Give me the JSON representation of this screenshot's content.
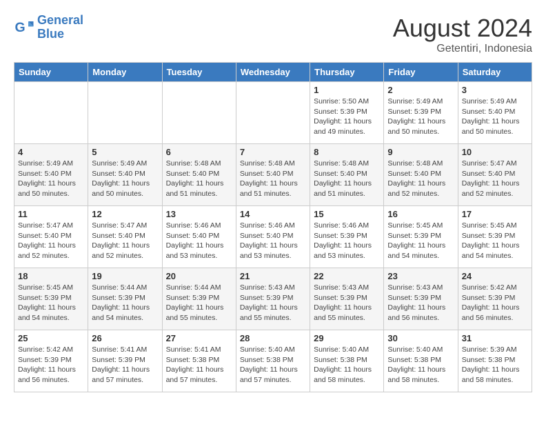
{
  "logo": {
    "line1": "General",
    "line2": "Blue"
  },
  "title": "August 2024",
  "location": "Getentiri, Indonesia",
  "weekdays": [
    "Sunday",
    "Monday",
    "Tuesday",
    "Wednesday",
    "Thursday",
    "Friday",
    "Saturday"
  ],
  "weeks": [
    [
      {
        "day": "",
        "info": ""
      },
      {
        "day": "",
        "info": ""
      },
      {
        "day": "",
        "info": ""
      },
      {
        "day": "",
        "info": ""
      },
      {
        "day": "1",
        "info": "Sunrise: 5:50 AM\nSunset: 5:39 PM\nDaylight: 11 hours\nand 49 minutes."
      },
      {
        "day": "2",
        "info": "Sunrise: 5:49 AM\nSunset: 5:39 PM\nDaylight: 11 hours\nand 50 minutes."
      },
      {
        "day": "3",
        "info": "Sunrise: 5:49 AM\nSunset: 5:40 PM\nDaylight: 11 hours\nand 50 minutes."
      }
    ],
    [
      {
        "day": "4",
        "info": "Sunrise: 5:49 AM\nSunset: 5:40 PM\nDaylight: 11 hours\nand 50 minutes."
      },
      {
        "day": "5",
        "info": "Sunrise: 5:49 AM\nSunset: 5:40 PM\nDaylight: 11 hours\nand 50 minutes."
      },
      {
        "day": "6",
        "info": "Sunrise: 5:48 AM\nSunset: 5:40 PM\nDaylight: 11 hours\nand 51 minutes."
      },
      {
        "day": "7",
        "info": "Sunrise: 5:48 AM\nSunset: 5:40 PM\nDaylight: 11 hours\nand 51 minutes."
      },
      {
        "day": "8",
        "info": "Sunrise: 5:48 AM\nSunset: 5:40 PM\nDaylight: 11 hours\nand 51 minutes."
      },
      {
        "day": "9",
        "info": "Sunrise: 5:48 AM\nSunset: 5:40 PM\nDaylight: 11 hours\nand 52 minutes."
      },
      {
        "day": "10",
        "info": "Sunrise: 5:47 AM\nSunset: 5:40 PM\nDaylight: 11 hours\nand 52 minutes."
      }
    ],
    [
      {
        "day": "11",
        "info": "Sunrise: 5:47 AM\nSunset: 5:40 PM\nDaylight: 11 hours\nand 52 minutes."
      },
      {
        "day": "12",
        "info": "Sunrise: 5:47 AM\nSunset: 5:40 PM\nDaylight: 11 hours\nand 52 minutes."
      },
      {
        "day": "13",
        "info": "Sunrise: 5:46 AM\nSunset: 5:40 PM\nDaylight: 11 hours\nand 53 minutes."
      },
      {
        "day": "14",
        "info": "Sunrise: 5:46 AM\nSunset: 5:40 PM\nDaylight: 11 hours\nand 53 minutes."
      },
      {
        "day": "15",
        "info": "Sunrise: 5:46 AM\nSunset: 5:39 PM\nDaylight: 11 hours\nand 53 minutes."
      },
      {
        "day": "16",
        "info": "Sunrise: 5:45 AM\nSunset: 5:39 PM\nDaylight: 11 hours\nand 54 minutes."
      },
      {
        "day": "17",
        "info": "Sunrise: 5:45 AM\nSunset: 5:39 PM\nDaylight: 11 hours\nand 54 minutes."
      }
    ],
    [
      {
        "day": "18",
        "info": "Sunrise: 5:45 AM\nSunset: 5:39 PM\nDaylight: 11 hours\nand 54 minutes."
      },
      {
        "day": "19",
        "info": "Sunrise: 5:44 AM\nSunset: 5:39 PM\nDaylight: 11 hours\nand 54 minutes."
      },
      {
        "day": "20",
        "info": "Sunrise: 5:44 AM\nSunset: 5:39 PM\nDaylight: 11 hours\nand 55 minutes."
      },
      {
        "day": "21",
        "info": "Sunrise: 5:43 AM\nSunset: 5:39 PM\nDaylight: 11 hours\nand 55 minutes."
      },
      {
        "day": "22",
        "info": "Sunrise: 5:43 AM\nSunset: 5:39 PM\nDaylight: 11 hours\nand 55 minutes."
      },
      {
        "day": "23",
        "info": "Sunrise: 5:43 AM\nSunset: 5:39 PM\nDaylight: 11 hours\nand 56 minutes."
      },
      {
        "day": "24",
        "info": "Sunrise: 5:42 AM\nSunset: 5:39 PM\nDaylight: 11 hours\nand 56 minutes."
      }
    ],
    [
      {
        "day": "25",
        "info": "Sunrise: 5:42 AM\nSunset: 5:39 PM\nDaylight: 11 hours\nand 56 minutes."
      },
      {
        "day": "26",
        "info": "Sunrise: 5:41 AM\nSunset: 5:39 PM\nDaylight: 11 hours\nand 57 minutes."
      },
      {
        "day": "27",
        "info": "Sunrise: 5:41 AM\nSunset: 5:38 PM\nDaylight: 11 hours\nand 57 minutes."
      },
      {
        "day": "28",
        "info": "Sunrise: 5:40 AM\nSunset: 5:38 PM\nDaylight: 11 hours\nand 57 minutes."
      },
      {
        "day": "29",
        "info": "Sunrise: 5:40 AM\nSunset: 5:38 PM\nDaylight: 11 hours\nand 58 minutes."
      },
      {
        "day": "30",
        "info": "Sunrise: 5:40 AM\nSunset: 5:38 PM\nDaylight: 11 hours\nand 58 minutes."
      },
      {
        "day": "31",
        "info": "Sunrise: 5:39 AM\nSunset: 5:38 PM\nDaylight: 11 hours\nand 58 minutes."
      }
    ]
  ]
}
